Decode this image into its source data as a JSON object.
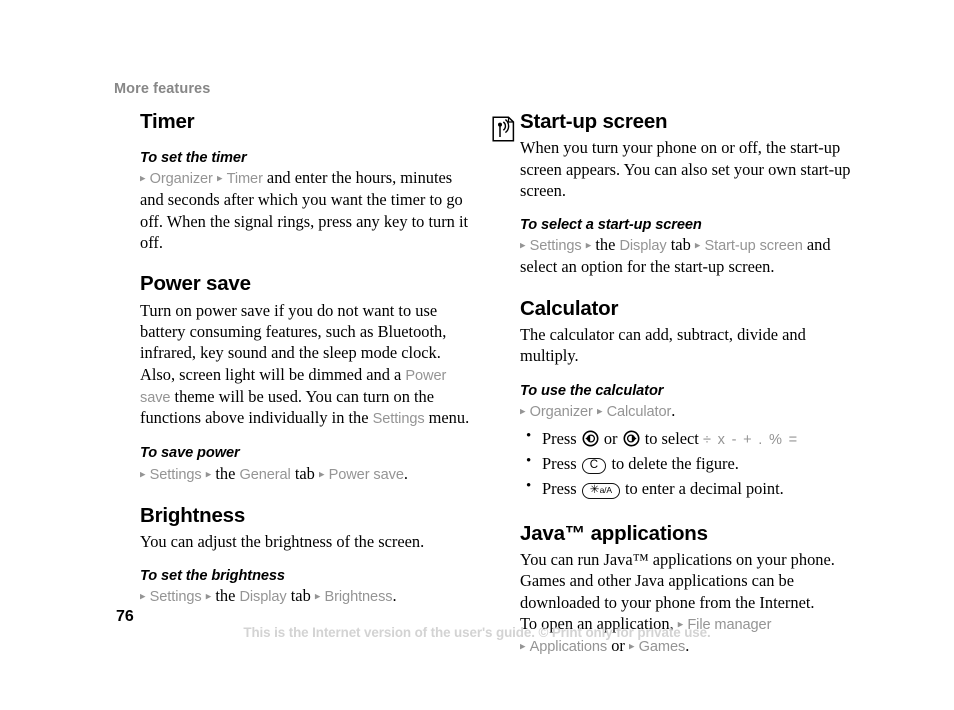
{
  "header": {
    "running_title": "More features"
  },
  "left_column": {
    "timer": {
      "heading": "Timer",
      "task_heading": "To set the timer",
      "nav": {
        "arrow": "▸",
        "item1": "Organizer",
        "item2": "Timer",
        "trailing_text": " and enter the hours, minutes and seconds after which you want the timer to go off. When the signal rings, press any key to turn it off."
      }
    },
    "power_save": {
      "heading": "Power save",
      "body_part1": "Turn on power save if you do not want to use battery consuming features, such as Bluetooth, infrared, key sound and the sleep mode clock. Also, screen light will be dimmed and a ",
      "ui_ref1": "Power save",
      "body_part2": " theme will be used. You can turn on the functions above individually in the ",
      "ui_ref2": "Settings",
      "body_part3": " menu.",
      "task_heading": "To save power",
      "nav": {
        "item1": "Settings",
        "connector1": "the",
        "item2": "General",
        "connector2": "tab",
        "item3": "Power save",
        "period": "."
      }
    },
    "brightness": {
      "heading": "Brightness",
      "body": "You can adjust the brightness of the screen.",
      "task_heading": "To set the brightness",
      "nav": {
        "item1": "Settings",
        "connector1": "the",
        "item2": "Display",
        "connector2": "tab",
        "item3": "Brightness",
        "period": "."
      }
    }
  },
  "right_column": {
    "startup_screen": {
      "icon": "note-signal-icon",
      "heading": "Start-up screen",
      "body": "When you turn your phone on or off, the start-up screen appears. You can also set your own start-up screen.",
      "task_heading": "To select a start-up screen",
      "nav": {
        "item1": "Settings",
        "connector1": "the",
        "item2": "Display",
        "connector2": "tab",
        "item3": "Start-up screen",
        "trailing_text": " and select an option for the start-up screen."
      }
    },
    "calculator": {
      "heading": "Calculator",
      "body": "The calculator can add, subtract, divide and multiply.",
      "task_heading": "To use the calculator",
      "nav": {
        "item1": "Organizer",
        "item2": "Calculator",
        "period": "."
      },
      "bullets": [
        {
          "bullet": "•",
          "text_before": "Press",
          "key1": "nav-left-key-icon",
          "between": "or",
          "key2": "nav-right-key-icon",
          "text_after": "to select",
          "operators": "÷ x - + . % ="
        },
        {
          "bullet": "•",
          "text_before": "Press",
          "key_label": "C",
          "text_after": "to delete the figure."
        },
        {
          "bullet": "•",
          "text_before": "Press",
          "key_symbol": "✳",
          "key_sub": "a/A",
          "text_after": "to enter a decimal point."
        }
      ]
    },
    "java": {
      "heading": "Java™ applications",
      "body": "You can run Java™ applications on your phone. Games and other Java applications can be downloaded to your phone from the Internet.",
      "open_line_text": "To open an application, ",
      "ui_ref1": "File manager",
      "ui_ref2": "Applications",
      "or_text": " or ",
      "ui_ref3": "Games",
      "period": "."
    }
  },
  "footer": {
    "page_number": "76",
    "note": "This is the Internet version of the user's guide. © Print only for private use."
  },
  "colors": {
    "ui_reference_gray": "#949494",
    "running_header_gray": "#878787",
    "footer_gray": "#d3d3d3",
    "text_black": "#000000"
  }
}
